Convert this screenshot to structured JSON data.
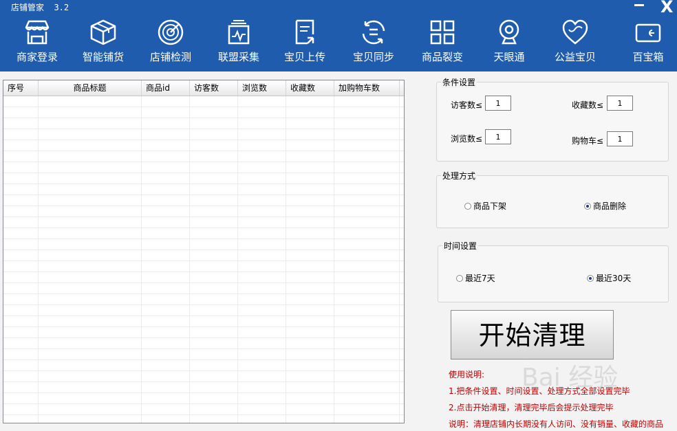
{
  "app": {
    "title": "店铺管家  3.2",
    "minimize_glyph": "–",
    "close_glyph": "X"
  },
  "toolbar": {
    "items": [
      {
        "label": "商家登录",
        "icon": "store-icon"
      },
      {
        "label": "智能铺货",
        "icon": "box-icon"
      },
      {
        "label": "店铺检测",
        "icon": "radar-icon"
      },
      {
        "label": "联盟采集",
        "icon": "collect-icon"
      },
      {
        "label": "宝贝上传",
        "icon": "upload-icon"
      },
      {
        "label": "宝贝同步",
        "icon": "sync-icon"
      },
      {
        "label": "商品裂变",
        "icon": "grid-icon"
      },
      {
        "label": "天眼通",
        "icon": "webcam-icon"
      },
      {
        "label": "公益宝贝",
        "icon": "heart-icon"
      },
      {
        "label": "百宝箱",
        "icon": "wallet-icon"
      }
    ]
  },
  "table": {
    "columns": [
      "序号",
      "商品标题",
      "商品id",
      "访客数",
      "浏览数",
      "收藏数",
      "加购物车数"
    ],
    "rows": []
  },
  "conditions": {
    "title": "条件设置",
    "visitors_label": "访客数≤",
    "visitors_value": "1",
    "favorites_label": "收藏数≤",
    "favorites_value": "1",
    "views_label": "浏览数≤",
    "views_value": "1",
    "cart_label": "购物车≤",
    "cart_value": "1"
  },
  "handling": {
    "title": "处理方式",
    "options": [
      {
        "label": "商品下架",
        "selected": false
      },
      {
        "label": "商品删除",
        "selected": true
      }
    ]
  },
  "time": {
    "title": "时间设置",
    "options": [
      {
        "label": "最近7天",
        "selected": false
      },
      {
        "label": "最近30天",
        "selected": true
      }
    ]
  },
  "start_button": {
    "label": "开始清理"
  },
  "instructions": {
    "heading": "使用说明:",
    "line1": "1.把条件设置、时间设置、处理方式全部设置完毕",
    "line2": "2.点击开始清理，清理完毕后会提示处理完毕",
    "line3": "说明：清理店铺内长期没有人访问、没有销量、收藏的商品"
  },
  "watermark": "Bai 经验",
  "colors": {
    "header_bg": "#1f5cae",
    "note_red": "#c00000",
    "radio_dot": "#1f3c88"
  }
}
